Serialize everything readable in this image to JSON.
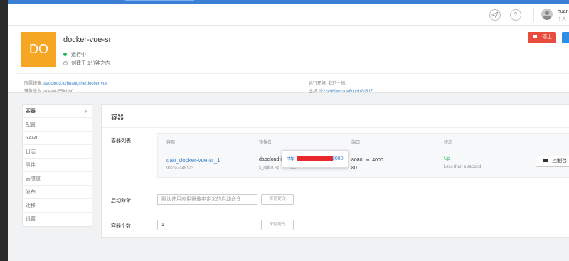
{
  "user": {
    "name": "huan",
    "sub": "个人"
  },
  "app": {
    "logo_text": "DO",
    "name": "docker-vue-sr",
    "status": "运行中",
    "created": "创建于 1分钟之内",
    "stop_label": "停止",
    "meta": {
      "image_label": "所属镜像:",
      "image_value": "daocloud.io/huangche/docker-vue",
      "version_label": "镜像版本:",
      "version_value": "master-55fcbb0",
      "env_label": "运行环境:",
      "env_value": "我的主机",
      "host_label": "主机:",
      "host_value": "i22ze980wxsue6codh2o5dZ"
    }
  },
  "sidebar": {
    "items": [
      {
        "label": "容器"
      },
      {
        "label": "配置"
      },
      {
        "label": "YAML"
      },
      {
        "label": "日志"
      },
      {
        "label": "事件"
      },
      {
        "label": "云隧道"
      },
      {
        "label": "发布"
      },
      {
        "label": "迁移"
      },
      {
        "label": "设置"
      }
    ],
    "active_chevron": "›"
  },
  "panel": {
    "title": "容器",
    "list_label": "容器列表",
    "table": {
      "headers": [
        "容器",
        "镜像名",
        "端口",
        "状态"
      ],
      "row": {
        "name": "dao_docker-vue-sr_1",
        "id": "992fa7c48123",
        "image": "daocloud.i",
        "image_cmd": "s_nginx -g",
        "image_cmd_tail": "off;",
        "port_from": "8080",
        "port_arrow": "➜",
        "port_to": "4000",
        "port_extra": "80",
        "status": "Up",
        "status_time": "Less than a second",
        "console_label": "控制台"
      }
    },
    "popup": {
      "link_prefix": "http",
      "link_suffix": "8080"
    },
    "start_cmd_label": "启动命令",
    "start_cmd_placeholder": "默认使用应用镜像中定义的启动命令",
    "save_label": "保存更改",
    "count_label": "容器个数",
    "count_value": "1"
  },
  "icons": {
    "send": "send-icon",
    "help": "?"
  },
  "colors": {
    "accent": "#3b7fd6",
    "logo": "#f5a623",
    "stop": "#e74c3c",
    "running": "#1fb55c",
    "link": "#3b83c8"
  }
}
